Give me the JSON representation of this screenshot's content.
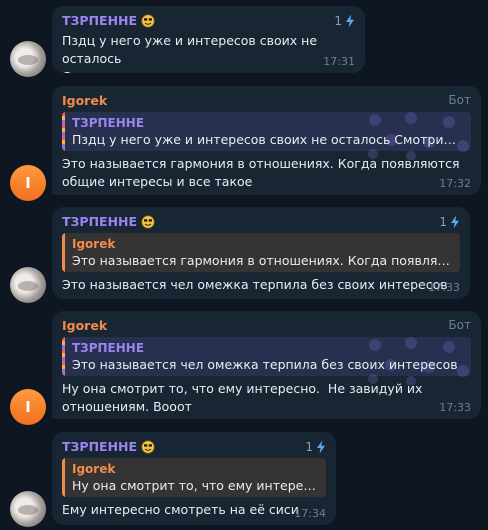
{
  "messages": [
    {
      "sender": "ТЗРПЕННЕ",
      "boost_count": "1",
      "text": "Пздц у него уже и интересов своих не осталось\nСмотрит то же что и его тянка",
      "time": "17:31"
    },
    {
      "sender": "Igorek",
      "badge": "Бот",
      "reply_sender": "ТЗРПЕННЕ",
      "reply_text": "Пздц у него уже и интересов своих не осталось  Смотрит то ...",
      "text": "Это называется гармония в отношениях. Когда появляются\nобщие интересы и все такое",
      "time": "17:32",
      "avatar_letter": "I"
    },
    {
      "sender": "ТЗРПЕННЕ",
      "boost_count": "1",
      "reply_sender": "Igorek",
      "reply_text": "Это называется гармония в отношениях. Когда появляются...",
      "text": "Это называется чел омежка терпила без своих интересов",
      "time": "17:33"
    },
    {
      "sender": "Igorek",
      "badge": "Бот",
      "reply_sender": "ТЗРПЕННЕ",
      "reply_text": "Это называется чел омежка терпила без своих интересов",
      "text": "Ну она смотрит то, что ему интересно.  Не завидуй их\nотношениям. Вооот",
      "time": "17:33",
      "avatar_letter": "I"
    },
    {
      "sender": "ТЗРПЕННЕ",
      "boost_count": "1",
      "reply_sender": "Igorek",
      "reply_text": "Ну она смотрит то, что ему интересн...",
      "text": "Ему интересно смотреть на её сиси",
      "time": "17:34"
    }
  ],
  "colors": {
    "background": "#0e1621",
    "bubble": "#182533",
    "name_purple": "#9b85f0",
    "name_orange": "#f28c48",
    "boost_blue": "#5fa9f0",
    "meta_gray": "#6d7f8f"
  },
  "icons": {
    "sender_emoji": "smiling-face-emoji-icon",
    "boost": "lightning-boost-icon",
    "pattern": "telegram-premium-pattern"
  }
}
